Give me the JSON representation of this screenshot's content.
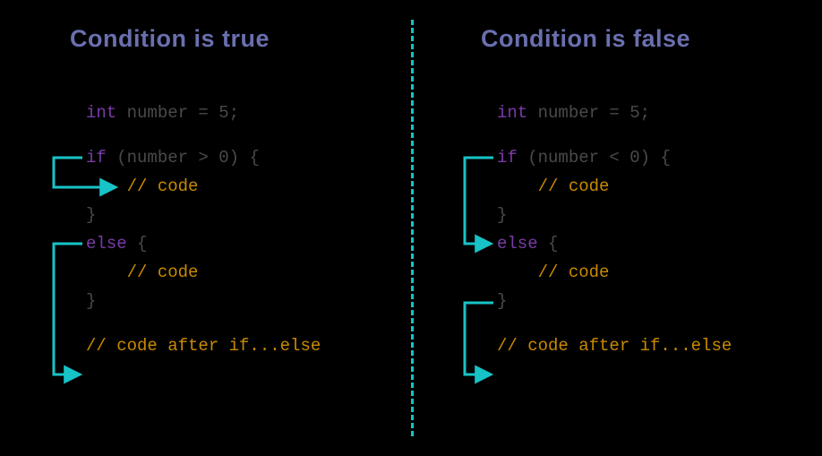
{
  "colors": {
    "background": "#000000",
    "heading": "#6a6fae",
    "keyword": "#7a3ba8",
    "comment": "#c98a00",
    "dim": "#4a4a4a",
    "flow_arrow": "#17c3c7",
    "divider": "#17c3c7"
  },
  "left": {
    "heading": "Condition is true",
    "code": {
      "decl_type": "int",
      "decl_rest": " number = 5;",
      "if_kw": "if",
      "if_cond": " (number > 0) {",
      "body_comment": "    // code",
      "close_brace": "}",
      "else_kw": "else",
      "else_open": " {",
      "after_comment": "// code after if...else"
    },
    "flow_description": "from 'if' line into if-body; from 'else' line skip to code-after"
  },
  "right": {
    "heading": "Condition is false",
    "code": {
      "decl_type": "int",
      "decl_rest": " number = 5;",
      "if_kw": "if",
      "if_cond": " (number < 0) {",
      "body_comment": "    // code",
      "close_brace": "}",
      "else_kw": "else",
      "else_open": " {",
      "after_comment": "// code after if...else"
    },
    "flow_description": "from 'if' line skip to 'else' line; from else-closing-brace to code-after"
  }
}
